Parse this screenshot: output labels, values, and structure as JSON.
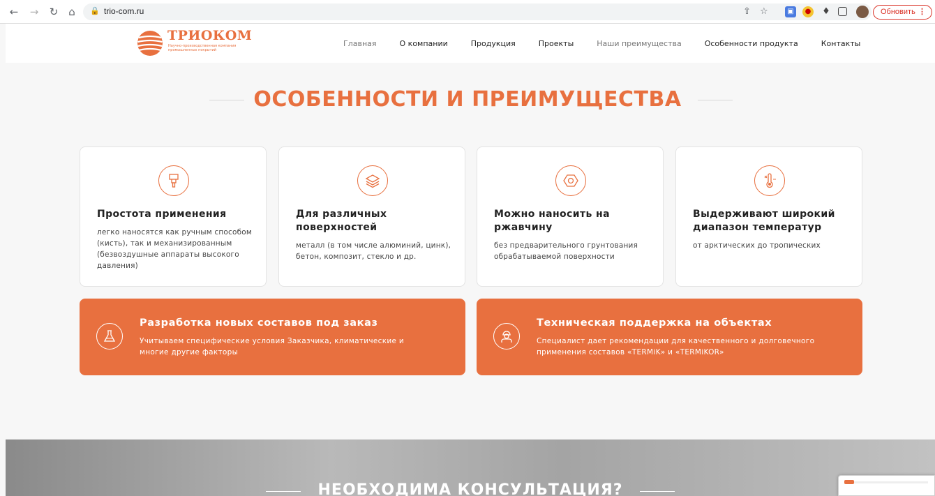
{
  "browser": {
    "url": "trio-com.ru",
    "update_label": "Обновить",
    "update_dots": "⋮",
    "icons": {
      "back": "arrow-left-icon",
      "forward": "arrow-right-icon",
      "reload": "reload-icon",
      "home": "home-icon",
      "lock": "lock-icon",
      "share": "share-icon",
      "star": "star-icon",
      "extensions": "puzzle-icon",
      "sidepanel": "side-panel-icon"
    }
  },
  "site": {
    "logo_name": "ТРИОКОМ",
    "logo_sub": "Научно-производственная компания промышленных покрытий",
    "menu": [
      {
        "label": "Главная",
        "muted": true
      },
      {
        "label": "О компании",
        "muted": false
      },
      {
        "label": "Продукция",
        "muted": false
      },
      {
        "label": "Проекты",
        "muted": false
      },
      {
        "label": "Наши преимущества",
        "muted": true
      },
      {
        "label": "Особенности продукта",
        "muted": false
      },
      {
        "label": "Контакты",
        "muted": false
      }
    ]
  },
  "section": {
    "title": "ОСОБЕННОСТИ И ПРЕИМУЩЕСТВА"
  },
  "cards": [
    {
      "title": "Простота применения",
      "text": "легко наносятся как ручным способом (кисть), так и механизированным (безвоздушные аппараты высокого давления)",
      "icon": "brush-icon"
    },
    {
      "title": "Для различных поверхностей",
      "text": "металл (в том числе алюминий, цинк), бетон, композит, стекло и др.",
      "icon": "layers-icon"
    },
    {
      "title": "Можно наносить на ржавчину",
      "text": "без предварительного грунтования обрабатываемой поверхности",
      "icon": "hex-nut-icon"
    },
    {
      "title": "Выдерживают широкий диапазон температур",
      "text": "от арктических до тропических",
      "icon": "thermometer-icon"
    }
  ],
  "banners": [
    {
      "title": "Разработка новых составов под заказ",
      "text": "Учитываем специфические условия Заказчика, климатические и многие другие факторы",
      "icon": "flask-icon"
    },
    {
      "title": "Техническая поддержка на объектах",
      "text": "Специалист дает рекомендации для качественного и долговечного применения составов «TERMiK» и «TERMiKOR»",
      "icon": "worker-icon"
    }
  ],
  "bottom": {
    "title": "НЕОБХОДИМА КОНСУЛЬТАЦИЯ?"
  },
  "colors": {
    "accent": "#e8703f",
    "background": "#f7f7f7",
    "text": "#222222"
  }
}
